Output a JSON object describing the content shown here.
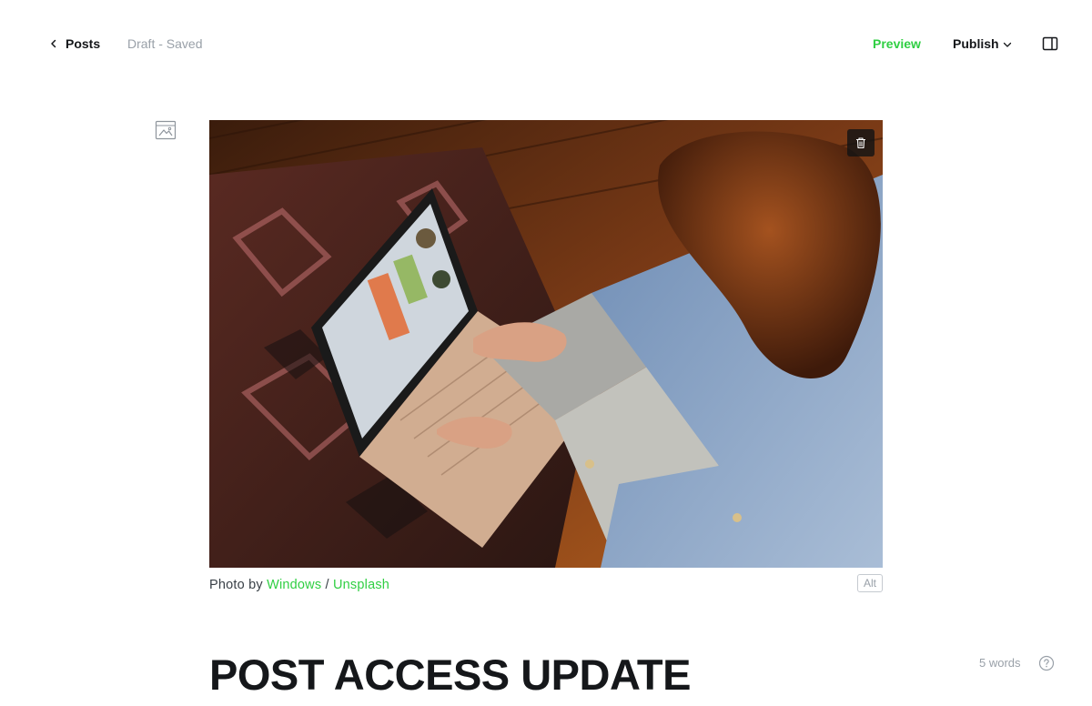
{
  "header": {
    "back_label": "Posts",
    "status": "Draft - Saved",
    "preview_label": "Preview",
    "publish_label": "Publish"
  },
  "feature_image": {
    "caption_prefix": "Photo by ",
    "author": "Windows",
    "separator": " / ",
    "source": "Unsplash",
    "alt_label": "Alt"
  },
  "post": {
    "title": "POST ACCESS UPDATE",
    "word_count": "5 words"
  },
  "colors": {
    "accent": "#30cf43",
    "text": "#15171a",
    "muted": "#99a0a8"
  },
  "icons": [
    "chevron-left-icon",
    "chevron-down-icon",
    "sidebar-toggle-icon",
    "image-icon",
    "trash-icon",
    "help-icon"
  ]
}
